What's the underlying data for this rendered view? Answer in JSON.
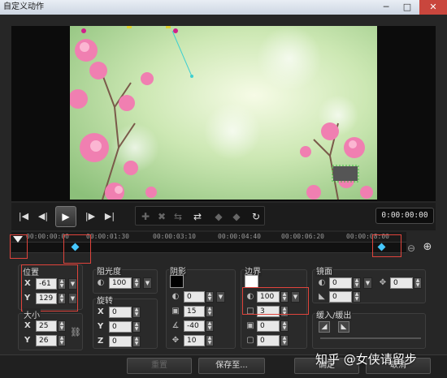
{
  "window": {
    "title": "自定义动作",
    "min": "─",
    "max": "□",
    "close": "✕"
  },
  "transport": {
    "prev_icon": "skip-back-icon",
    "rewind_icon": "step-back-icon",
    "play_icon": "play-icon",
    "forward_icon": "step-forward-icon",
    "next_icon": "skip-forward-icon",
    "timecode": "0:00:00:00"
  },
  "ruler": {
    "ticks": [
      "00:00:00:00",
      "00:00:01:30",
      "00:00:03:10",
      "00:00:04:40",
      "00:00:06:20",
      "00:00:08:00"
    ]
  },
  "zoom": {
    "out_icon": "zoom-out-icon",
    "in_icon": "zoom-in-icon"
  },
  "position": {
    "title": "位置",
    "x_label": "X",
    "x": "-61",
    "y_label": "Y",
    "y": "129"
  },
  "size": {
    "title": "大小",
    "x_label": "X",
    "x": "25",
    "y_label": "Y",
    "y": "26"
  },
  "opacity": {
    "title": "阻光度",
    "value": "100"
  },
  "rotation": {
    "title": "旋转",
    "x_label": "X",
    "x": "0",
    "y_label": "Y",
    "y": "0",
    "z_label": "Z",
    "z": "0"
  },
  "shadow": {
    "title": "阴影",
    "opacity": "0",
    "blur": "15",
    "angle": "-40",
    "distance": "10",
    "color": "#000000"
  },
  "border": {
    "title": "边界",
    "opacity": "100",
    "width": "3",
    "blur": "0",
    "extra": "0",
    "color": "#ffffff"
  },
  "reflection": {
    "title": "镜面",
    "opacity": "0",
    "blur": "0",
    "distance": "0"
  },
  "ease": {
    "title": "缓入/缓出"
  },
  "buttons": {
    "reset": "重置",
    "save": "保存至...",
    "ok": "确定",
    "cancel": "取消"
  },
  "watermark": "知乎 @女侠请留步"
}
